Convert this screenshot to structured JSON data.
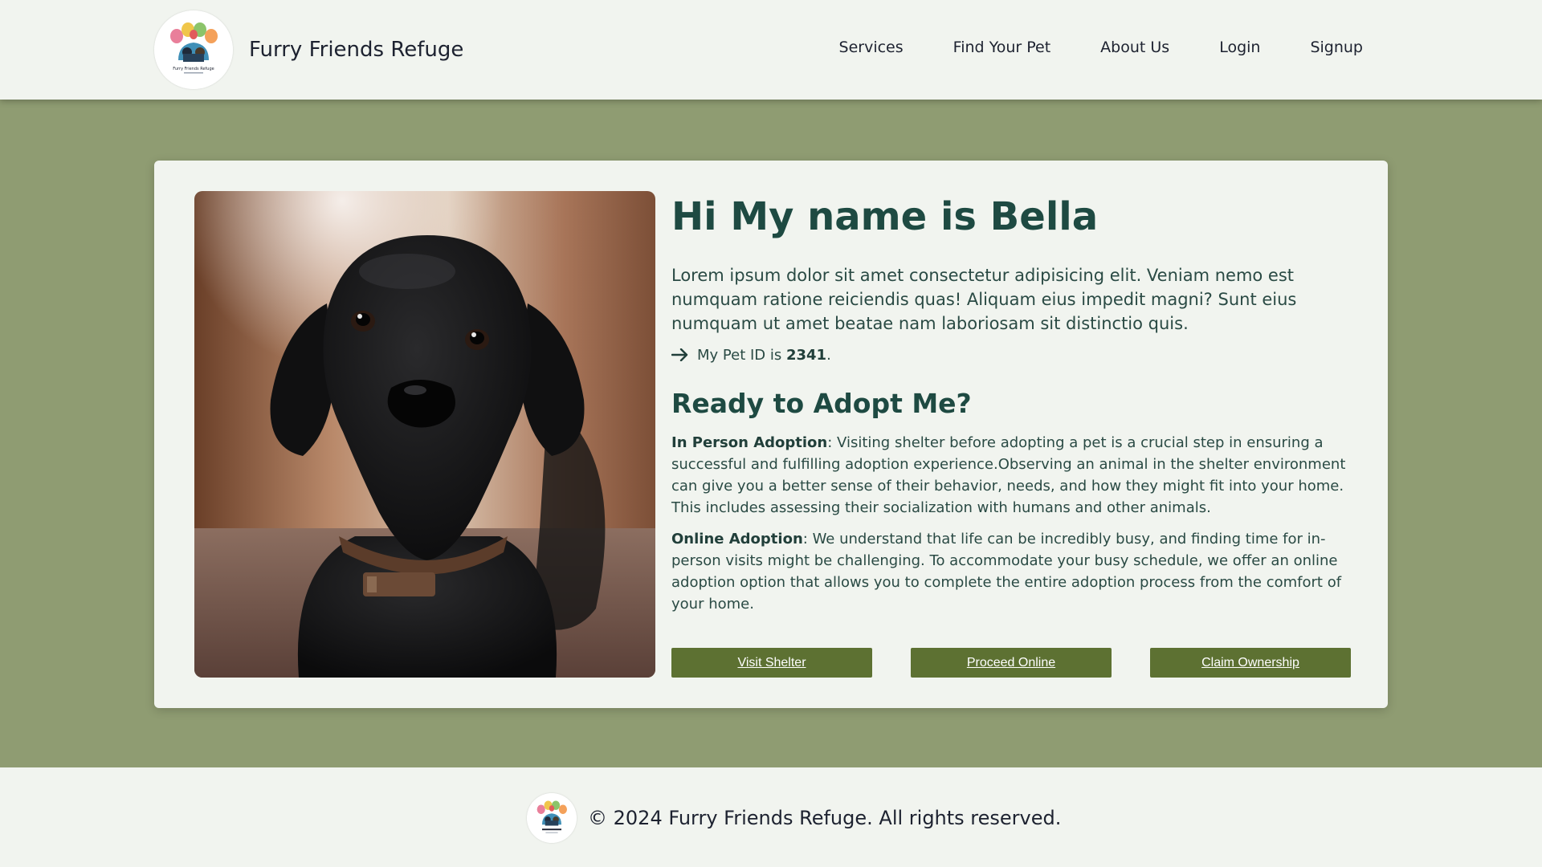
{
  "header": {
    "brand_title": "Furry Friends Refuge",
    "logo_caption": "Furry Friends Refuge",
    "nav": [
      "Services",
      "Find Your Pet",
      "About Us",
      "Login",
      "Signup"
    ]
  },
  "pet": {
    "name_heading": "Hi My name is Bella",
    "description": "Lorem ipsum dolor sit amet consectetur adipisicing elit. Veniam nemo est numquam ratione reiciendis quas! Aliquam eius impedit magni? Sunt eius numquam ut amet beatae nam laboriosam sit distinctio quis.",
    "id_prefix": "My Pet ID is",
    "id_value": "2341",
    "id_suffix": ".",
    "photo_alt_icon": "black-labrador-photo"
  },
  "adoption": {
    "title": "Ready to Adopt Me?",
    "in_person_label": "In Person Adoption",
    "in_person_text": ": Visiting shelter before adopting a pet is a crucial step in ensuring a successful and fulfilling adoption experience.Observing an animal in the shelter environment can give you a better sense of their behavior, needs, and how they might fit into your home. This includes assessing their socialization with humans and other animals.",
    "online_label": "Online Adoption",
    "online_text": ": We understand that life can be incredibly busy, and finding time for in-person visits might be challenging. To accommodate your busy schedule, we offer an online adoption option that allows you to complete the entire adoption process from the comfort of your home."
  },
  "buttons": {
    "visit": "Visit Shelter",
    "online": "Proceed Online",
    "claim": "Claim Ownership"
  },
  "footer": {
    "text": "© 2024 Furry Friends Refuge. All rights reserved."
  },
  "colors": {
    "page_background": "#8f9c72",
    "panel_background": "#f1f4ef",
    "heading": "#1e4a42",
    "button": "#5d7132"
  }
}
